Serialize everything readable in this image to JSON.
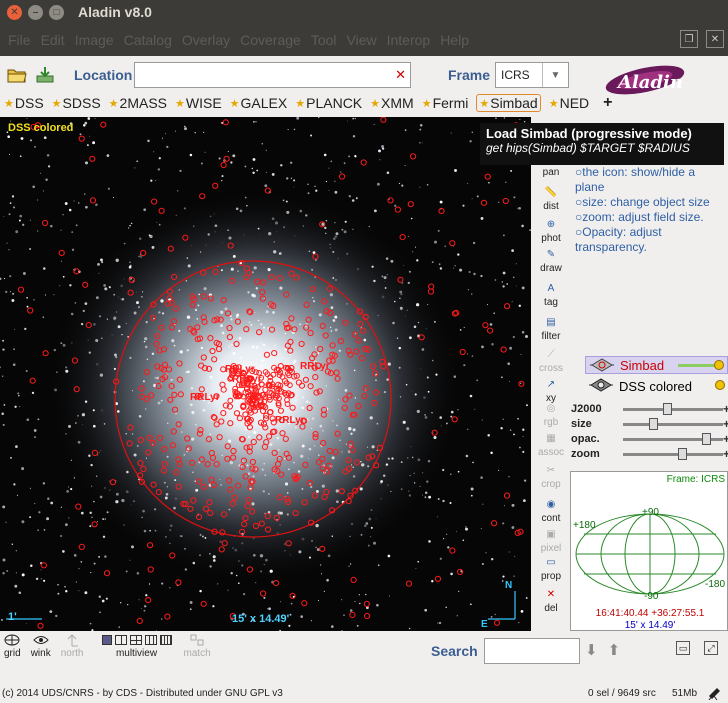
{
  "window": {
    "title": "Aladin v8.0"
  },
  "menu": [
    "File",
    "Edit",
    "Image",
    "Catalog",
    "Overlay",
    "Coverage",
    "Tool",
    "View",
    "Interop",
    "Help"
  ],
  "toolbar": {
    "location_label": "Location",
    "location_value": "",
    "frame_label": "Frame",
    "frame_value": "ICRS",
    "logo": "Aladin"
  },
  "hips": [
    {
      "label": "DSS",
      "active": false
    },
    {
      "label": "SDSS",
      "active": false
    },
    {
      "label": "2MASS",
      "active": false
    },
    {
      "label": "WISE",
      "active": false
    },
    {
      "label": "GALEX",
      "active": false
    },
    {
      "label": "PLANCK",
      "active": false
    },
    {
      "label": "XMM",
      "active": false
    },
    {
      "label": "Fermi",
      "active": false
    },
    {
      "label": "Simbad",
      "active": true
    },
    {
      "label": "NED",
      "active": false
    }
  ],
  "hips_add": "+",
  "view": {
    "survey_label": "DSS colored",
    "fov": "15' x 14.49'",
    "scale": "1'",
    "north": "N",
    "east": "E",
    "annotations": [
      "RRLyr",
      "RRLyr",
      "RRLyr",
      "RRLyr",
      "RRLyr"
    ]
  },
  "tools": [
    {
      "label": "pan",
      "dim": false
    },
    {
      "label": "dist",
      "dim": false
    },
    {
      "label": "phot",
      "dim": false
    },
    {
      "label": "draw",
      "dim": false
    },
    {
      "label": "tag",
      "dim": false
    },
    {
      "label": "filter",
      "dim": false
    },
    {
      "label": "cross",
      "dim": true
    },
    {
      "label": "xy",
      "dim": false
    },
    {
      "label": "rgb",
      "dim": true
    },
    {
      "label": "assoc",
      "dim": true
    },
    {
      "label": "crop",
      "dim": true
    },
    {
      "label": "cont",
      "dim": false
    },
    {
      "label": "pixel",
      "dim": true
    },
    {
      "label": "prop",
      "dim": false
    },
    {
      "label": "del",
      "dim": false
    }
  ],
  "tooltip": {
    "title": "Load Simbad (progressive mode)",
    "cmd": "get hips(Simbad) $TARGET $RADIUS"
  },
  "help": [
    "the icon: show/hide a plane",
    "size: change object size",
    "zoom: adjust field size.",
    "Opacity: adjust transparency."
  ],
  "layers": [
    {
      "name": "Simbad",
      "color": "#cc0000"
    },
    {
      "name": "DSS colored",
      "color": "#000000"
    }
  ],
  "controls": [
    {
      "label": "J2000",
      "value": 0.44
    },
    {
      "label": "size",
      "value": 0.28
    },
    {
      "label": "opac.",
      "value": 0.86
    },
    {
      "label": "zoom",
      "value": 0.6
    }
  ],
  "minimap": {
    "frame": "Frame: ICRS",
    "top": "+90",
    "bottom": "-90",
    "left": "+180",
    "right": "-180",
    "coord": "16:41:40.44 +36:27:55.1",
    "fov": "15' x 14.49'"
  },
  "bottom_tools": [
    {
      "label": "grid",
      "dim": false
    },
    {
      "label": "wink",
      "dim": false
    },
    {
      "label": "north",
      "dim": true
    },
    {
      "label": "multiview",
      "dim": false
    },
    {
      "label": "match",
      "dim": true
    }
  ],
  "search": {
    "label": "Search",
    "value": ""
  },
  "status": {
    "left": "(c) 2014 UDS/CNRS - by CDS - Distributed under GNU GPL v3",
    "sources": "0 sel / 9649 src",
    "memory": "51Mb"
  }
}
